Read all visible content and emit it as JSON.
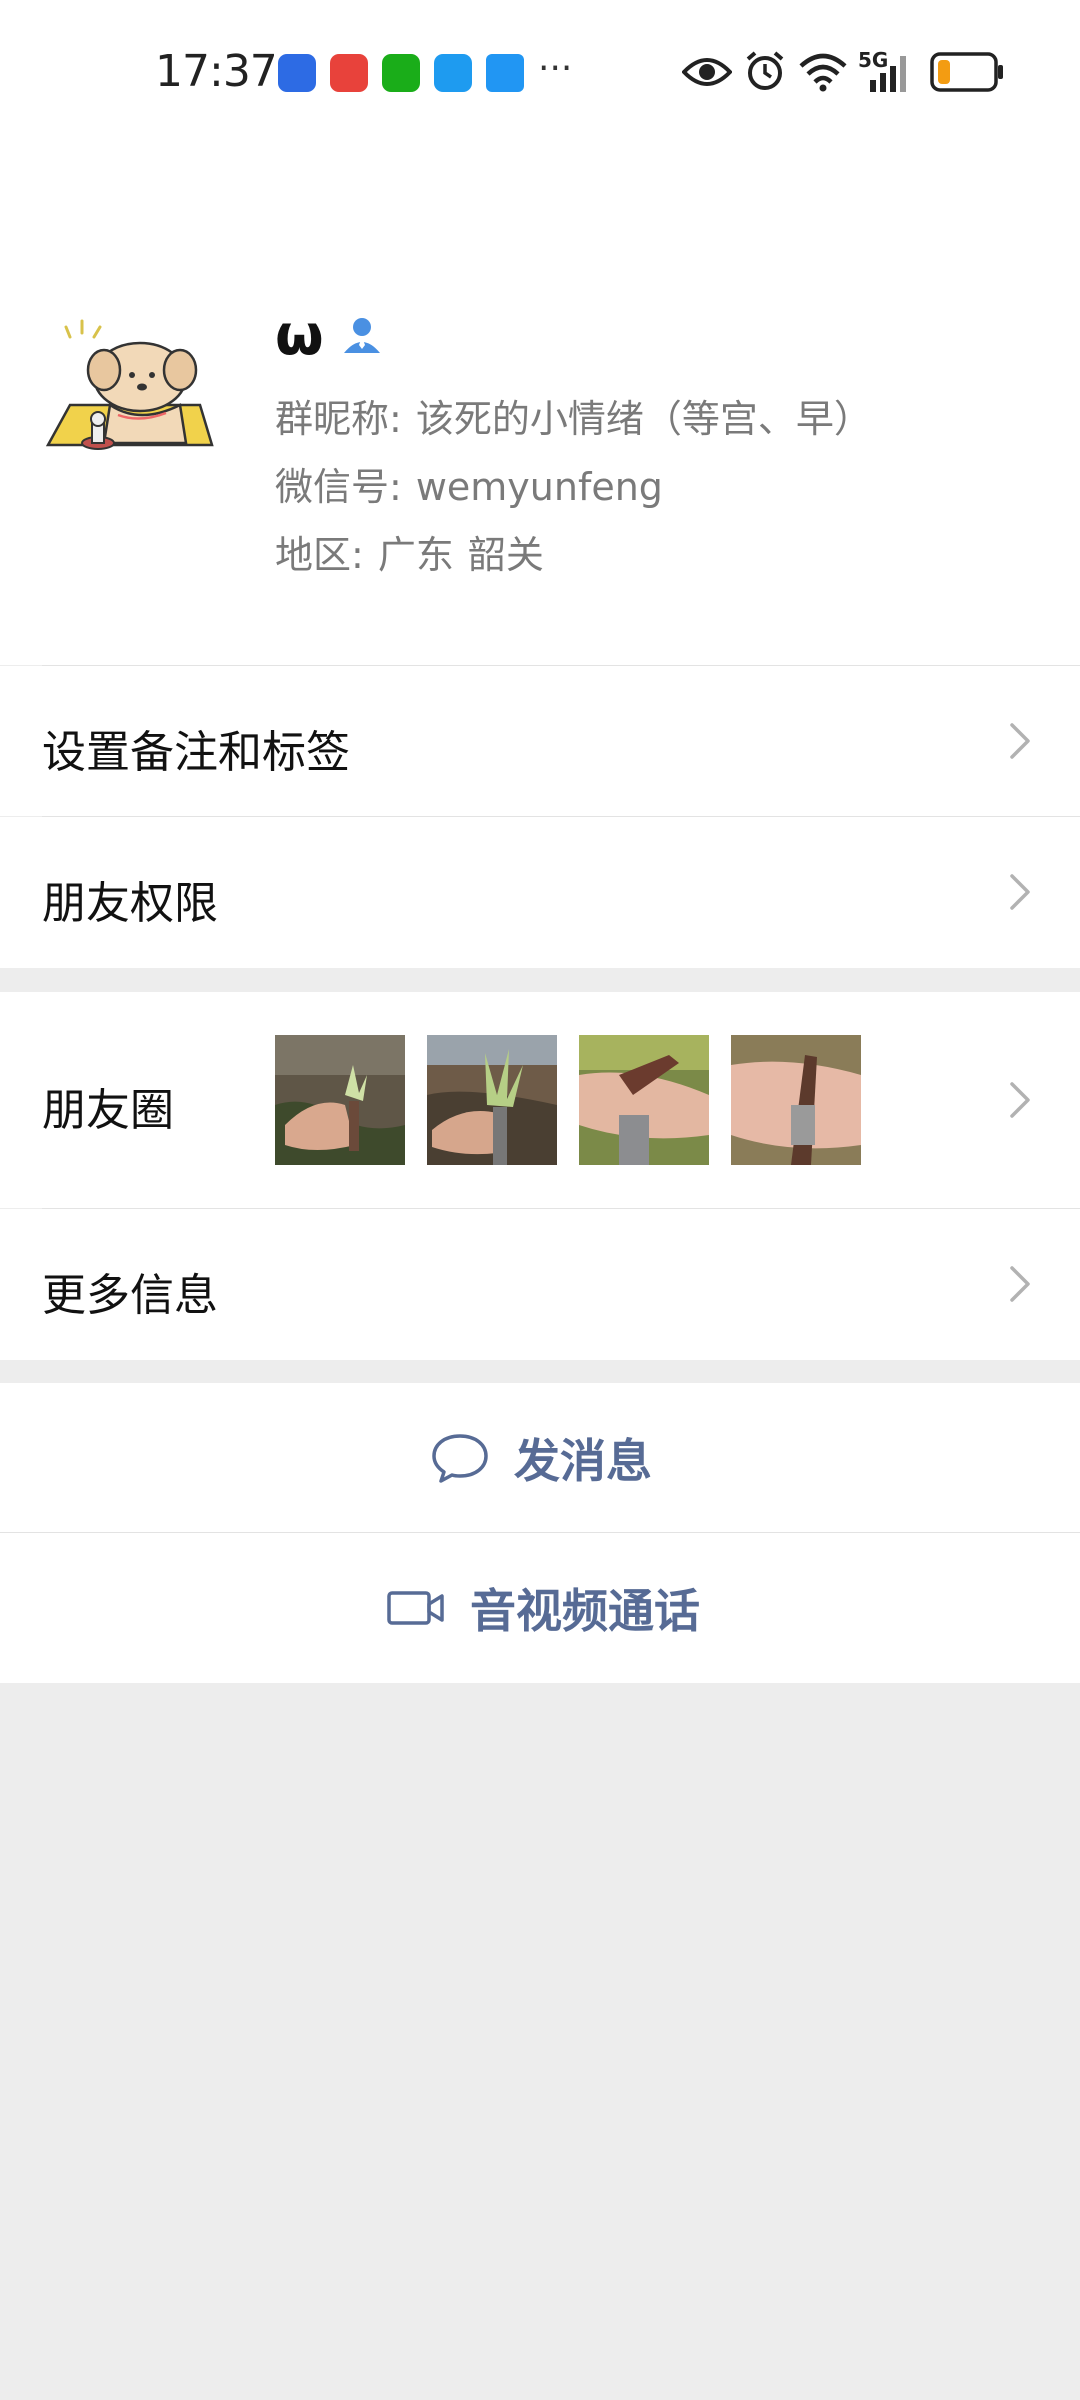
{
  "status_bar": {
    "time": "17:37",
    "more_indicator": "···",
    "network_label": "5G",
    "battery_color": "#f39c12"
  },
  "nav": {
    "back_icon": "chevron-left-icon",
    "more_icon": "more-horizontal-icon"
  },
  "profile": {
    "name": "ω",
    "group_nickname_label": "群昵称:",
    "group_nickname": "该死的小情绪（等宫、早）",
    "wechat_id_label": "微信号:",
    "wechat_id": "wemyunfeng",
    "region_label": "地区:",
    "region_province": "广东",
    "region_city": "韶关"
  },
  "rows": {
    "remark_tags": "设置备注和标签",
    "friend_permissions": "朋友权限",
    "moments": "朋友圈",
    "more_info": "更多信息"
  },
  "actions": {
    "send_message": "发消息",
    "video_call": "音视频通话"
  },
  "colors": {
    "link": "#576b95",
    "background": "#ededed"
  }
}
